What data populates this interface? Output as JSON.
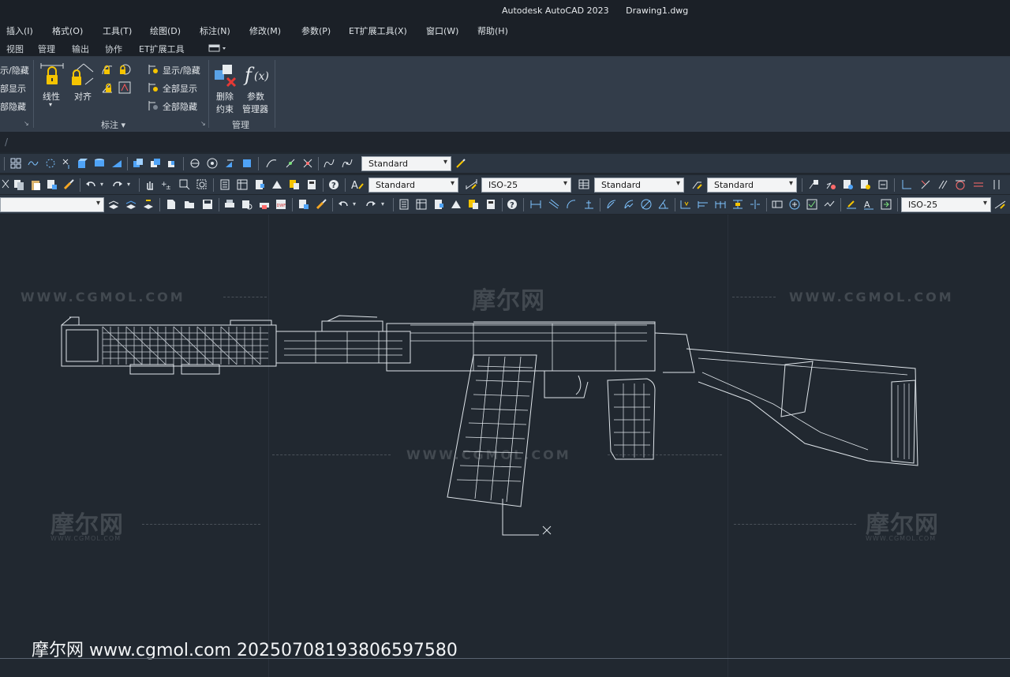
{
  "titlebar": {
    "app": "Autodesk AutoCAD 2023",
    "file": "Drawing1.dwg"
  },
  "menubar": [
    "插入(I)",
    "格式(O)",
    "工具(T)",
    "绘图(D)",
    "标注(N)",
    "修改(M)",
    "参数(P)",
    "ET扩展工具(X)",
    "窗口(W)",
    "帮助(H)"
  ],
  "ribbon_tabs": [
    "视图",
    "管理",
    "输出",
    "协作",
    "ET扩展工具"
  ],
  "ribbon": {
    "left_partial": [
      "示/隐藏",
      "部显示",
      "部隐藏"
    ],
    "dim_panel": {
      "linear": "线性",
      "aligned": "对齐",
      "show_hide": "显示/隐藏",
      "show_all": "全部显示",
      "hide_all": "全部隐藏",
      "label": "标注 ▾"
    },
    "manage_panel": {
      "delete_constraint_l1": "删除",
      "delete_constraint_l2": "约束",
      "param_manager_l1": "参数",
      "param_manager_l2": "管理器",
      "label": "管理"
    }
  },
  "toolbar1": {
    "style_dropdown": "Standard"
  },
  "toolbar2": {
    "text_style": "Standard",
    "dim_style": "ISO-25",
    "table_style": "Standard",
    "multileader_style": "Standard"
  },
  "toolbar3": {
    "layer_dropdown": "",
    "dim_style": "ISO-25"
  },
  "canvas": {
    "watermark_cn": "摩尔网",
    "watermark_url": "WWW.CGMOL.COM",
    "footer": "摩尔网 www.cgmol.com 20250708193806597580"
  },
  "colors": {
    "canvas_bg": "#212830",
    "ribbon_bg": "#333d4a",
    "titlebar_bg": "#1b2027",
    "toolbar_bg": "#2c3642",
    "wire": "#dfe5ea"
  }
}
